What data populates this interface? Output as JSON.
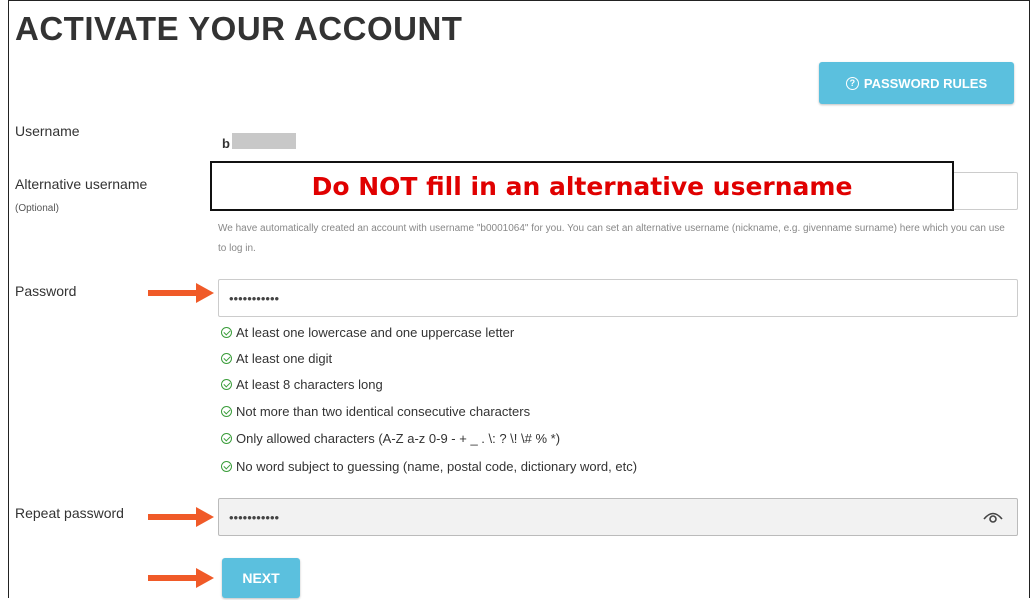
{
  "header": {
    "title": "ACTIVATE YOUR ACCOUNT"
  },
  "buttons": {
    "password_rules": "PASSWORD RULES",
    "next": "NEXT"
  },
  "fields": {
    "username": {
      "label": "Username",
      "value": "b"
    },
    "alternative_username": {
      "label": "Alternative username",
      "sublabel": "(Optional)",
      "help": "We have automatically created an account with username \"b0001064\" for you. You can set an alternative username (nickname, e.g. givenname surname) here which you can use to log in."
    },
    "password": {
      "label": "Password",
      "value": "•••••••••••"
    },
    "repeat_password": {
      "label": "Repeat password",
      "value": "•••••••••••"
    }
  },
  "password_rules": [
    "At least one lowercase and one uppercase letter",
    "At least one digit",
    "At least 8 characters long",
    "Not more than two identical consecutive characters",
    "Only allowed characters (A-Z a-z 0-9 - + _ . \\: ? \\! \\# % *)",
    "No word subject to guessing (name, postal code, dictionary word, etc)"
  ],
  "annotation": {
    "notice": "Do NOT fill in an alternative username"
  },
  "colors": {
    "accent": "#5bc0de",
    "arrow": "#f05a28",
    "notice_text": "#e00000",
    "check": "#3a9d3a"
  },
  "icons": {
    "rules": "question-circle-icon",
    "check": "check-circle-icon",
    "reveal": "eye-icon",
    "pointer": "arrow-right-icon"
  }
}
